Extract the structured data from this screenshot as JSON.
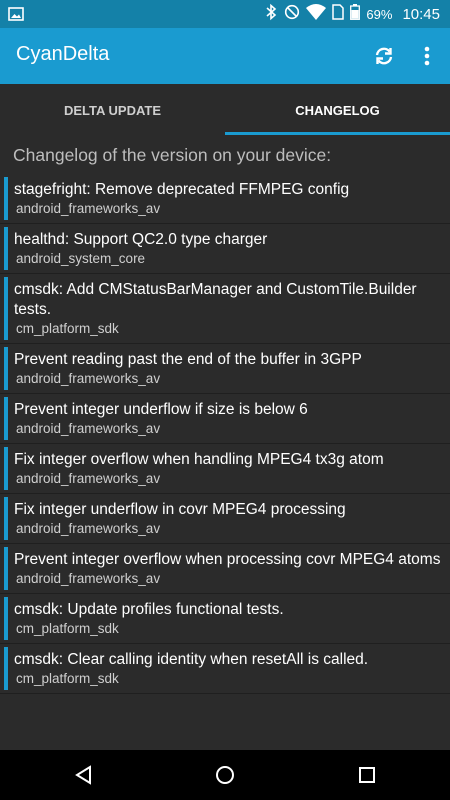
{
  "status_bar": {
    "battery_percent": "69%",
    "time": "10:45",
    "icons": [
      "image-icon",
      "bluetooth-icon",
      "do-not-disturb-icon",
      "wifi-icon",
      "sim-icon",
      "battery-icon"
    ]
  },
  "toolbar": {
    "title": "CyanDelta",
    "icons": [
      "refresh-icon",
      "more-vert-icon"
    ]
  },
  "tabs": [
    {
      "label": "DELTA UPDATE",
      "selected": false
    },
    {
      "label": "CHANGELOG",
      "selected": true
    }
  ],
  "header": "Changelog of the version on your device:",
  "changelog": [
    {
      "title": "stagefright: Remove deprecated FFMPEG config",
      "repo": "android_frameworks_av"
    },
    {
      "title": "healthd: Support QC2.0 type charger",
      "repo": "android_system_core"
    },
    {
      "title": "cmsdk: Add CMStatusBarManager and CustomTile.Builder tests.",
      "repo": "cm_platform_sdk"
    },
    {
      "title": "Prevent reading past the end of the buffer in 3GPP",
      "repo": "android_frameworks_av"
    },
    {
      "title": "Prevent integer underflow if size is below 6",
      "repo": "android_frameworks_av"
    },
    {
      "title": "Fix integer overflow when handling MPEG4 tx3g atom",
      "repo": "android_frameworks_av"
    },
    {
      "title": "Fix integer underflow in covr MPEG4 processing",
      "repo": "android_frameworks_av"
    },
    {
      "title": "Prevent integer overflow when processing covr MPEG4 atoms",
      "repo": "android_frameworks_av"
    },
    {
      "title": "cmsdk: Update profiles functional tests.",
      "repo": "cm_platform_sdk"
    },
    {
      "title": "cmsdk: Clear calling identity when resetAll is called.",
      "repo": "cm_platform_sdk"
    }
  ],
  "nav_bar": {
    "icons": [
      "back-icon",
      "home-icon",
      "recents-icon"
    ]
  },
  "colors": {
    "status_bar": "#1481a8",
    "toolbar": "#1a9bd0",
    "accent": "#1a9bd0",
    "background": "#2b2b2b"
  }
}
